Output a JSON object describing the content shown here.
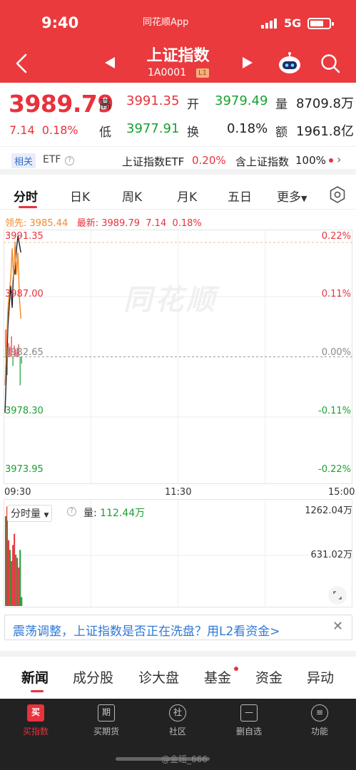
{
  "status": {
    "time": "9:40",
    "app_name": "同花顺App",
    "network": "5G"
  },
  "header": {
    "title": "上证指数",
    "code": "1A0001",
    "level_badge": "L1"
  },
  "quote": {
    "price": "3989.79",
    "change": "7.14",
    "change_pct": "0.18%",
    "high_label": "高",
    "high": "3991.35",
    "low_label": "低",
    "low": "3977.91",
    "open_label": "开",
    "open": "3979.49",
    "turnover_label": "换",
    "turnover": "0.18%",
    "volume_label": "量",
    "volume": "8709.8万",
    "amount_label": "额",
    "amount": "1961.8亿"
  },
  "etf": {
    "tag": "相关",
    "label": "ETF",
    "name": "上证指数ETF",
    "pct": "0.20%",
    "hold_name": "含上证指数",
    "hold_pct": "100%"
  },
  "tabs": {
    "intraday": "分时",
    "day": "日K",
    "week": "周K",
    "month": "月K",
    "five_day": "五日",
    "more": "更多"
  },
  "legend": {
    "lead_label": "领先:",
    "lead_value": "3985.44",
    "latest_label": "最新:",
    "latest_value": "3989.79",
    "latest_change": "7.14",
    "latest_pct": "0.18%"
  },
  "chart_data": {
    "type": "line",
    "y_labels_left": [
      "3991.35",
      "3987.00",
      "3982.65",
      "3978.30",
      "3973.95"
    ],
    "y_labels_right": [
      "0.22%",
      "0.11%",
      "0.00%",
      "-0.11%",
      "-0.22%"
    ],
    "ylim": [
      3973.95,
      3991.35
    ],
    "prev_close": 3982.65,
    "x_labels": [
      "09:30",
      "11:30",
      "15:00"
    ],
    "total_minutes": 240,
    "series": [
      {
        "color": "#222222",
        "values": [
          3978.6,
          3981.5,
          3984.8,
          3986.4,
          3987.8,
          3986.2,
          3989.2,
          3988.6,
          3990.5,
          3991.4,
          3990.8,
          3990.2
        ]
      },
      {
        "color": "#f08a2c",
        "values": [
          3980.6,
          3983.4,
          3986.1,
          3987.3,
          3988.4,
          3990.5,
          3988.2,
          3991.0,
          3988.6,
          3990.2,
          3986.9,
          3985.4
        ]
      }
    ],
    "watermark": "同花顺",
    "bars": [
      {
        "v": 4.8,
        "c": "r"
      },
      {
        "v": -3.2,
        "c": "g"
      },
      {
        "v": 2.4,
        "c": "r"
      },
      {
        "v": 1.8,
        "c": "r"
      },
      {
        "v": 3.6,
        "c": "r"
      },
      {
        "v": -1.6,
        "c": "g"
      },
      {
        "v": 2.0,
        "c": "r"
      },
      {
        "v": 0.8,
        "c": "r"
      },
      {
        "v": 1.6,
        "c": "r"
      },
      {
        "v": 2.2,
        "c": "r"
      },
      {
        "v": -5.0,
        "c": "g"
      },
      {
        "v": -1.2,
        "c": "g"
      }
    ]
  },
  "volume_chart": {
    "select_label": "分时量",
    "vol_label": "量:",
    "vol_value": "112.44万",
    "max_label": "1262.04万",
    "mid_label": "631.02万",
    "max": 1262.04,
    "bars": [
      {
        "v": 1120,
        "c": "g"
      },
      {
        "v": 1240,
        "c": "r"
      },
      {
        "v": 820,
        "c": "r"
      },
      {
        "v": 700,
        "c": "g"
      },
      {
        "v": 560,
        "c": "r"
      },
      {
        "v": 760,
        "c": "r"
      },
      {
        "v": 900,
        "c": "r"
      },
      {
        "v": 640,
        "c": "g"
      },
      {
        "v": 600,
        "c": "r"
      },
      {
        "v": 480,
        "c": "r"
      },
      {
        "v": 700,
        "c": "g"
      },
      {
        "v": 112,
        "c": "g"
      }
    ]
  },
  "promo": {
    "text": "震荡调整，上证指数是否正在洗盘？用L2看资金>"
  },
  "news_tabs": {
    "news": "新闻",
    "components": "成分股",
    "diagnose": "诊大盘",
    "fund": "基金",
    "capital": "资金",
    "movement": "异动"
  },
  "bottom_nav": {
    "buy": {
      "icon": "买",
      "label": "买指数"
    },
    "futures": {
      "icon": "期",
      "label": "买期货"
    },
    "community": {
      "icon": "社",
      "label": "社区"
    },
    "remove": {
      "icon": "—",
      "label": "删自选"
    },
    "functions": {
      "icon": "≡",
      "label": "功能"
    }
  },
  "watermark": "@金瑶_666",
  "colors": {
    "header_bg": "#ea3a3e",
    "up": "#e8323c",
    "down": "#18a032",
    "lead": "#f08a2c"
  }
}
